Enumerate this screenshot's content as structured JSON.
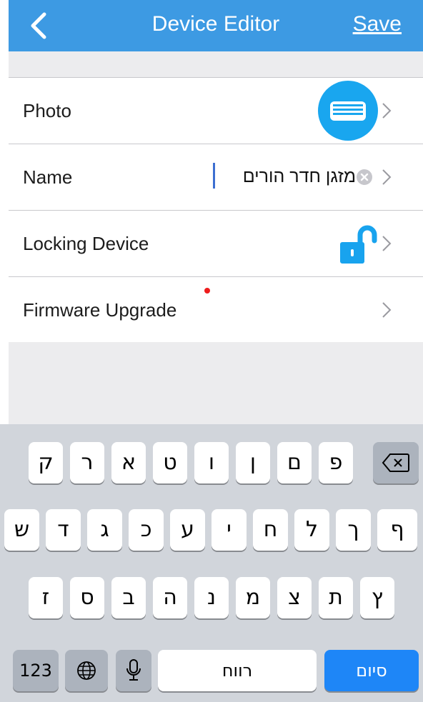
{
  "navbar": {
    "title": "Device Editor",
    "save_label": "Save",
    "color": "#3d9ae3"
  },
  "rows": {
    "photo": {
      "label": "Photo"
    },
    "name": {
      "label": "Name",
      "value": "מזגן חדר הורים"
    },
    "locking": {
      "label": "Locking Device"
    },
    "firmware": {
      "label": "Firmware Upgrade"
    }
  },
  "keyboard": {
    "row1": [
      "ק",
      "ר",
      "א",
      "ט",
      "ו",
      "ן",
      "ם",
      "פ"
    ],
    "row2": [
      "ש",
      "ד",
      "ג",
      "כ",
      "ע",
      "י",
      "ח",
      "ל",
      "ך",
      "ף"
    ],
    "row3": [
      "ז",
      "ס",
      "ב",
      "ה",
      "נ",
      "מ",
      "צ",
      "ת",
      "ץ"
    ],
    "numbers_label": "123",
    "space_label": "רווח",
    "done_label": "סיום"
  }
}
